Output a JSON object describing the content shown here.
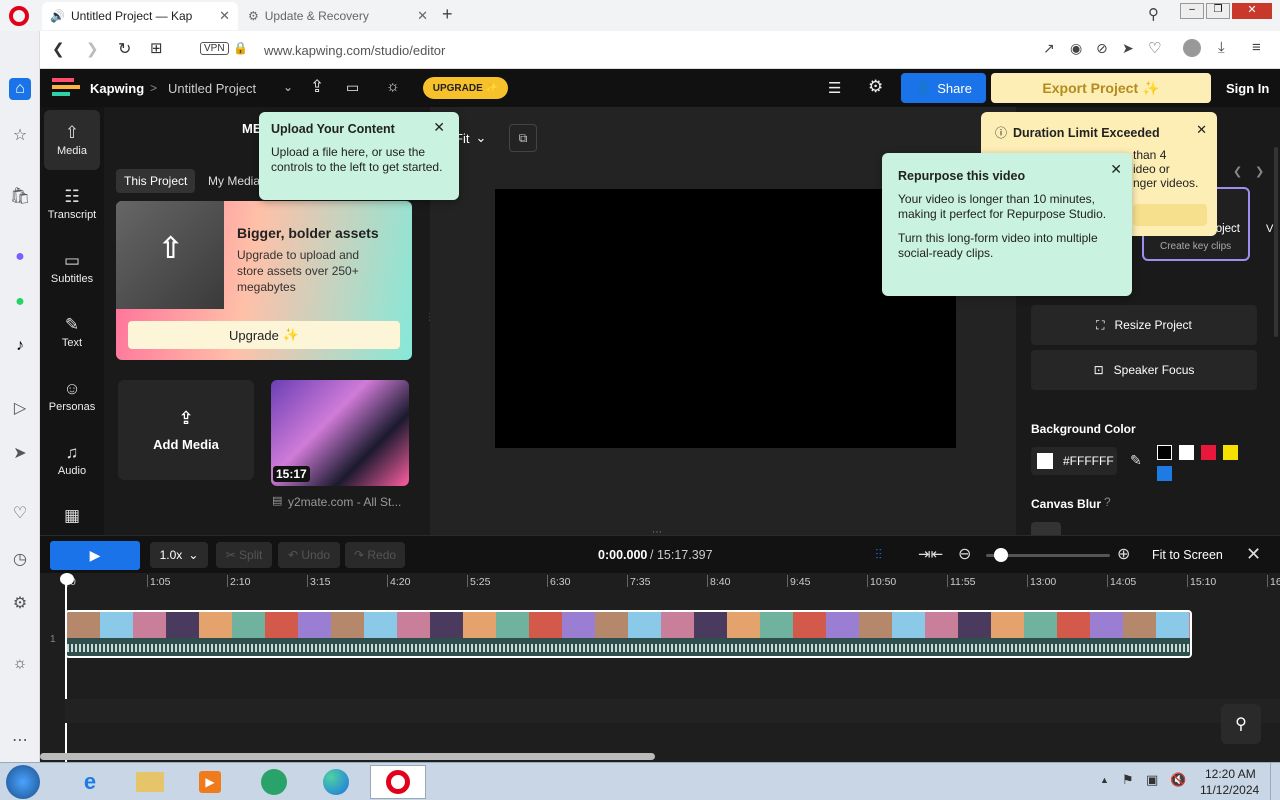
{
  "browser": {
    "tabs": [
      {
        "label": "Untitled Project — Kap",
        "active": true
      },
      {
        "label": "Update & Recovery",
        "active": false
      }
    ],
    "vpn_label": "VPN",
    "url": "www.kapwing.com/studio/editor"
  },
  "app": {
    "brand": "Kapwing",
    "breadcrumb_sep": ">",
    "project_name": "Untitled Project",
    "upgrade_label": "UPGRADE",
    "share_label": "Share",
    "export_label": "Export Project",
    "signin_label": "Sign In",
    "leftnav": [
      {
        "label": "Media",
        "icon": "upload-icon"
      },
      {
        "label": "Transcript",
        "icon": "transcript-icon"
      },
      {
        "label": "Subtitles",
        "icon": "subtitles-icon"
      },
      {
        "label": "Text",
        "icon": "text-icon"
      },
      {
        "label": "Personas",
        "icon": "person-icon"
      },
      {
        "label": "Audio",
        "icon": "audio-icon"
      }
    ],
    "media": {
      "header": "ME",
      "tabs": [
        "This Project",
        "My Media"
      ],
      "promo_title": "Bigger, bolder assets",
      "promo_text": "Upgrade to upload and store assets over 250+ megabytes",
      "promo_button": "Upgrade",
      "add_media": "Add Media",
      "clip_duration": "15:17",
      "clip_name": "y2mate.com - All St..."
    },
    "canvas": {
      "fit_label": "Fit"
    },
    "upload_popup": {
      "title": "Upload Your Content",
      "text": "Upload a file here, or use the controls to the left to get started."
    },
    "repurpose_popup": {
      "title": "Repurpose this video",
      "text1": "Your video is longer than 10 minutes, making it perfect for Repurpose Studio.",
      "text2": "Turn this long-form video into multiple social-ready clips."
    },
    "duration_popup": {
      "title": "Duration Limit Exceeded",
      "line1": "than 4",
      "line2": "ideo or",
      "line3": "nger videos."
    },
    "right": {
      "card_title": "oject",
      "card_sub": "Create key clips",
      "card_partial": "V",
      "resize_label": "Resize Project",
      "speaker_label": "Speaker Focus",
      "bg_color_label": "Background Color",
      "bg_hex": "#FFFFFF",
      "swatches": [
        "#000000",
        "#ffffff",
        "#e8173c",
        "#f5e000",
        "#1e7be6"
      ],
      "blur_label": "Canvas Blur"
    },
    "timeline": {
      "speed": "1.0x",
      "split": "Split",
      "undo": "Undo",
      "redo": "Redo",
      "current_time": "0:00.000",
      "total_time": "/ 15:17.397",
      "fit_screen": "Fit to Screen",
      "track_number": "1",
      "ticks": [
        "0",
        "1:05",
        "2:10",
        "3:15",
        "4:20",
        "5:25",
        "6:30",
        "7:35",
        "8:40",
        "9:45",
        "10:50",
        "11:55",
        "13:00",
        "14:05",
        "15:10",
        "16"
      ]
    }
  },
  "taskbar": {
    "time": "12:20 AM",
    "date": "11/12/2024"
  },
  "colors": {
    "accent_blue": "#1a73e8",
    "upgrade_yellow": "#f6c12b",
    "export_bg": "#fdeeb6",
    "popup_green": "#c9f2e0"
  }
}
